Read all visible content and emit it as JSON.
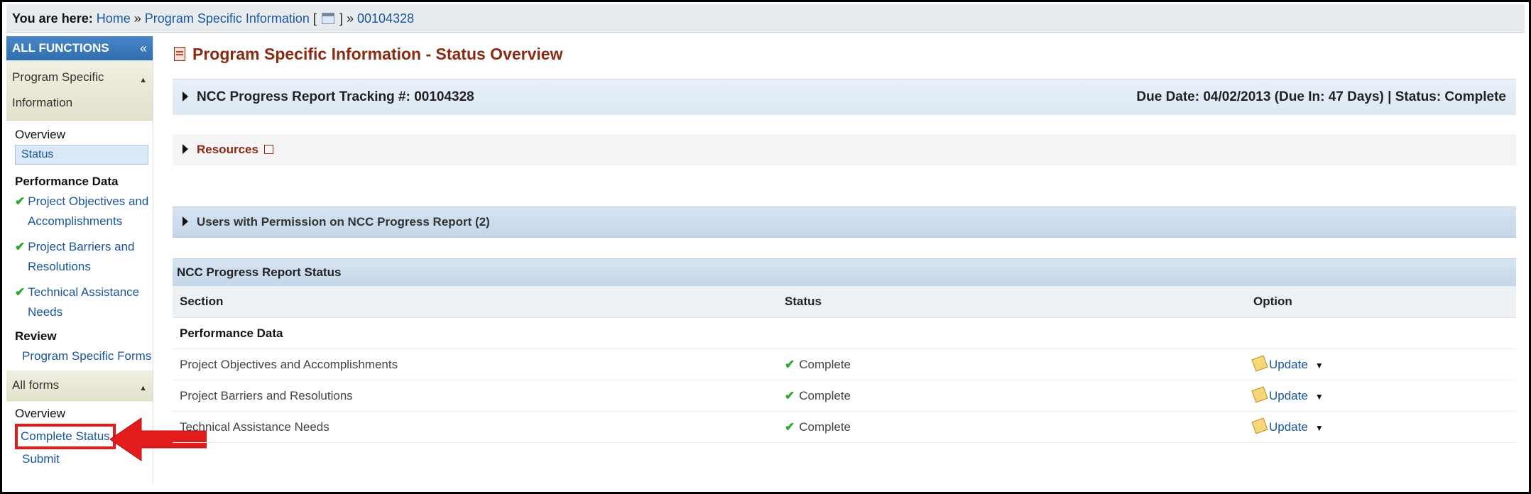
{
  "breadcrumb": {
    "label": "You are here:",
    "home": "Home",
    "sep1": "»",
    "program": "Program Specific Information",
    "bracket_open": "[",
    "bracket_close": "]",
    "sep2": "»",
    "tracking": "00104328"
  },
  "sidebar": {
    "header": "ALL FUNCTIONS",
    "collapse_glyph": "«",
    "group1": {
      "title": "Program Specific Information"
    },
    "overview": "Overview",
    "status": "Status",
    "performance_heading": "Performance Data",
    "perf_items": [
      {
        "line1": "Project Objectives and",
        "line2": "Accomplishments"
      },
      {
        "line1": "Project Barriers and",
        "line2": "Resolutions"
      },
      {
        "line1": "Technical Assistance",
        "line2": "Needs"
      }
    ],
    "review_heading": "Review",
    "review_item": "Program Specific Forms",
    "group2": {
      "title": "All forms"
    },
    "all_overview": "Overview",
    "complete_status": "Complete Status",
    "submit": "Submit"
  },
  "main": {
    "title": "Program Specific Information - Status Overview",
    "tracking_bar": {
      "left": "NCC Progress Report Tracking #: 00104328",
      "right": "Due Date: 04/02/2013 (Due In: 47 Days) | Status: Complete"
    },
    "resources": "Resources",
    "users_bar": "Users with Permission on NCC Progress Report (2)",
    "table": {
      "title": "NCC Progress Report Status",
      "columns": [
        "Section",
        "Status",
        "Option"
      ],
      "section_row": "Performance Data",
      "rows": [
        {
          "section": "Project Objectives and Accomplishments",
          "status": "Complete",
          "option": "Update"
        },
        {
          "section": "Project Barriers and Resolutions",
          "status": "Complete",
          "option": "Update"
        },
        {
          "section": "Technical Assistance Needs",
          "status": "Complete",
          "option": "Update"
        }
      ]
    }
  },
  "colors": {
    "accent": "#1a56a0",
    "title": "#8a2a12",
    "highlight": "#e21c1c",
    "check": "#2da62d"
  },
  "icons": {
    "check": "check-icon",
    "update": "pencil-icon",
    "dropdown": "caret-down-icon",
    "external": "external-link-icon",
    "calendar": "calendar-icon"
  }
}
